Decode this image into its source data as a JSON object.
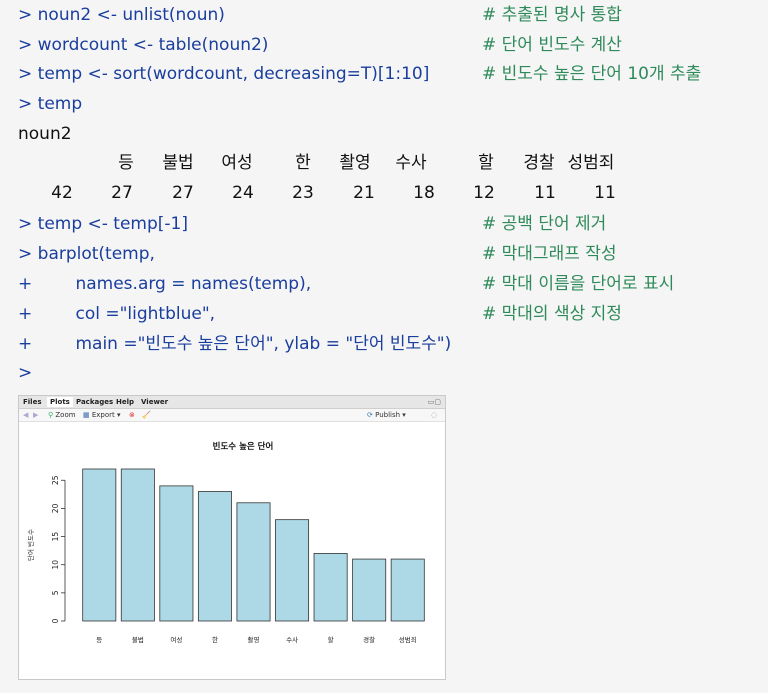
{
  "console": {
    "lines": [
      {
        "code": "> noun2 <- unlist(noun)",
        "comment": "# 추출된 명사 통합"
      },
      {
        "code": "> wordcount <- table(noun2)",
        "comment": "# 단어 빈도수 계산"
      },
      {
        "code": "> temp <- sort(wordcount, decreasing=T)[1:10]",
        "comment": "# 빈도수 높은 단어 10개 추출"
      },
      {
        "code": "> temp",
        "comment": ""
      }
    ],
    "output_header": "noun2",
    "table_words": [
      "등",
      "불법",
      "여성",
      "한",
      "촬영",
      "수사",
      "할",
      "경찰",
      "성범죄"
    ],
    "table_counts": [
      "42",
      "27",
      "27",
      "24",
      "23",
      "21",
      "18",
      "12",
      "11",
      "11"
    ],
    "lines2": [
      {
        "code": "> temp <- temp[-1]",
        "comment": "# 공백 단어 제거"
      },
      {
        "code": "> barplot(temp,",
        "comment": "# 막대그래프 작성"
      },
      {
        "code": "+        names.arg = names(temp),",
        "comment": "# 막대 이름을 단어로 표시"
      },
      {
        "code": "+        col =\"lightblue\",",
        "comment": "# 막대의 색상 지정"
      },
      {
        "code": "+        main =\"빈도수 높은 단어\", ylab = \"단어 빈도수\")",
        "comment": ""
      },
      {
        "code": ">",
        "comment": ""
      }
    ]
  },
  "pane": {
    "tabs": [
      "Files",
      "Plots",
      "Packages",
      "Help",
      "Viewer"
    ],
    "active_tab": "Plots",
    "toolbar": {
      "zoom": "Zoom",
      "export": "Export ▾",
      "publish": "Publish ▾"
    }
  },
  "chart_data": {
    "type": "bar",
    "title": "빈도수 높은 단어",
    "ylabel": "단어 빈도수",
    "xlabel": "",
    "categories": [
      "등",
      "불법",
      "여성",
      "한",
      "촬영",
      "수사",
      "할",
      "경찰",
      "성범죄"
    ],
    "values": [
      27,
      27,
      24,
      23,
      21,
      18,
      12,
      11,
      11
    ],
    "ylim": [
      0,
      27
    ],
    "yticks": [
      0,
      5,
      10,
      15,
      20,
      25
    ],
    "bar_color": "#add8e6",
    "grid": false
  }
}
